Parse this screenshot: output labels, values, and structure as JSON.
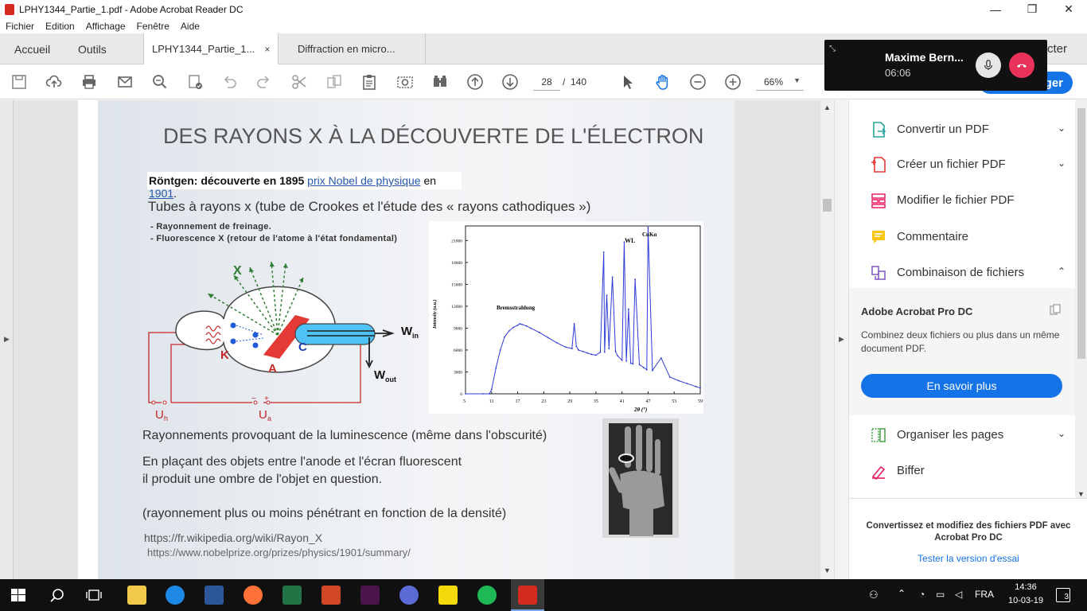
{
  "window": {
    "title": "LPHY1344_Partie_1.pdf - Adobe Acrobat Reader DC",
    "minimize": "—",
    "maximize": "❐",
    "close": "✕"
  },
  "menu": [
    "Fichier",
    "Edition",
    "Affichage",
    "Fenêtre",
    "Aide"
  ],
  "tabs": {
    "home": "Accueil",
    "tools": "Outils",
    "doc1": "LPHY1344_Partie_1...",
    "doc2": "Diffraction en micro...",
    "close": "×",
    "right_partial": "cter"
  },
  "toolbar": {
    "page_current": "28",
    "page_separator": "/",
    "page_total": "140",
    "zoom": "66%",
    "share_partial": "ger"
  },
  "slide": {
    "title": "DES RAYONS X À LA DÉCOUVERTE DE L'ÉLECTRON",
    "roentgen_bold": "Röntgen: découverte en 1895",
    "roentgen_link1": "prix Nobel de physique",
    "roentgen_mid": " en ",
    "roentgen_link2": "1901",
    "roentgen_end": ".",
    "tubes": "Tubes à rayons x (tube de Crookes et l'étude des « rayons cathodiques »)",
    "bullet1": "- Rayonnement de freinage.",
    "bullet2": "- Fluorescence X (retour de l'atome à l'état fondamental)",
    "tube_labels": {
      "X": "X",
      "K": "K",
      "A": "A",
      "C": "C",
      "Win": "W",
      "Win_sub": "in",
      "Wout": "W",
      "Wout_sub": "out",
      "Uh": "U",
      "Uh_sub": "h",
      "Ua": "U",
      "Ua_sub": "a",
      "minus": "−",
      "plus": "+"
    },
    "luminescence": "Rayonnements provoquant de la luminescence (même dans l'obscurité)",
    "placing1": "En plaçant des objets entre l'anode et l'écran fluorescent",
    "placing2": "il produit une ombre de l'objet en question.",
    "penetrant": "(rayonnement plus ou moins pénétrant en fonction de la densité)",
    "link1": "https://fr.wikipedia.org/wiki/Rayon_X",
    "link2": "https://www.nobelprize.org/prizes/physics/1901/summary/"
  },
  "chart_data": {
    "type": "line",
    "title": "",
    "xlabel": "2θ (°)",
    "ylabel": "Intensity (a.u.)",
    "xlim": [
      5,
      59
    ],
    "ylim": [
      0,
      23000
    ],
    "x_ticks": [
      "5",
      "11",
      "17",
      "23",
      "29",
      "35",
      "41",
      "47",
      "53",
      "59"
    ],
    "y_ticks": [
      "0",
      "3000",
      "6000",
      "9000",
      "12000",
      "15000",
      "18000",
      "21000"
    ],
    "annotations": [
      "Bremsstrahlung",
      "WL",
      "CuKα"
    ],
    "series": [
      {
        "x": [
          5,
          9,
          10.5,
          11,
          12,
          13,
          14,
          15,
          16,
          17,
          17.5,
          18,
          19,
          20,
          22,
          24,
          26,
          28,
          29.5,
          30,
          30.5,
          31,
          32,
          33,
          34,
          35,
          36,
          36.8,
          37,
          37.5,
          38,
          38.8,
          39.5,
          40,
          41,
          41.5,
          42,
          42.5,
          43,
          43.5,
          44,
          45,
          46,
          46.7,
          47,
          48,
          50,
          52,
          54,
          56,
          58,
          59
        ],
        "y": [
          0,
          0,
          0,
          600,
          3500,
          6000,
          7800,
          8600,
          9100,
          9400,
          9600,
          9500,
          9300,
          9000,
          8400,
          7700,
          7000,
          6400,
          6200,
          9600,
          6500,
          6000,
          5800,
          5600,
          5400,
          5300,
          5700,
          19400,
          5700,
          13500,
          6200,
          16000,
          5800,
          5200,
          4600,
          20800,
          4500,
          11600,
          4200,
          4100,
          15700,
          4000,
          3600,
          3300,
          22800,
          3200,
          4900,
          2300,
          1800,
          1400,
          1000,
          800
        ]
      }
    ]
  },
  "call": {
    "name": "Maxime Bern...",
    "time": "06:06"
  },
  "right_pane": {
    "tools": [
      {
        "label": "Convertir un PDF",
        "chev": "⌄"
      },
      {
        "label": "Créer un fichier PDF",
        "chev": "⌄"
      },
      {
        "label": "Modifier le fichier PDF",
        "chev": ""
      },
      {
        "label": "Commentaire",
        "chev": ""
      },
      {
        "label": "Combinaison de fichiers",
        "chev": "⌃"
      }
    ],
    "promo_title": "Adobe Acrobat Pro DC",
    "promo_text": "Combinez deux fichiers ou plus dans un même document PDF.",
    "promo_button": "En savoir plus",
    "tools2": [
      {
        "label": "Organiser les pages",
        "chev": "⌄"
      },
      {
        "label": "Biffer",
        "chev": ""
      }
    ],
    "footer_text": "Convertissez et modifiez des fichiers PDF avec Acrobat Pro DC",
    "footer_link": "Tester la version d'essai"
  },
  "taskbar": {
    "lang": "FRA",
    "time": "14:36",
    "date": "10-03-19",
    "notif_count": "3"
  },
  "colors": {
    "accent_blue": "#1473e6",
    "link_blue": "#2558a8",
    "tube_red": "#c62828",
    "tube_cyan": "#4fc3f7",
    "ray_green": "#2e7d32",
    "hangup_red": "#e8325a",
    "chart_line": "#2f3bd6"
  }
}
